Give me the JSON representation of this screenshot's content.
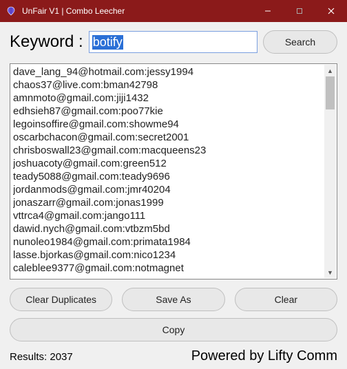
{
  "titlebar": {
    "title": "UnFair V1 | Combo Leecher"
  },
  "search": {
    "label": "Keyword :",
    "value": "botify",
    "button": "Search"
  },
  "results": {
    "items": [
      "dave_lang_94@hotmail.com:jessy1994",
      "chaos37@live.com:bman42798",
      "amnmoto@gmail.com:jiji1432",
      "edhsieh87@gmail.com:poo77kie",
      "legoinsoffire@gmail.com:showme94",
      "oscarbchacon@gmail.com:secret2001",
      "chrisboswall23@gmail.com:macqueens23",
      "joshuacoty@gmail.com:green512",
      "teady5088@gmail.com:teady9696",
      "jordanmods@gmail.com:jmr40204",
      "jonaszarr@gmail.com:jonas1999",
      "vttrca4@gmail.com:jango111",
      "dawid.nych@gmail.com:vtbzm5bd",
      "nunoleo1984@gmail.com:primata1984",
      "lasse.bjorkas@gmail.com:nico1234",
      "caleblee9377@gmail.com:notmagnet"
    ]
  },
  "actions": {
    "clear_duplicates": "Clear Duplicates",
    "save_as": "Save As",
    "clear": "Clear",
    "copy": "Copy"
  },
  "status": {
    "results_label": "Results: 2037",
    "powered": "Powered by Lifty Comm"
  }
}
